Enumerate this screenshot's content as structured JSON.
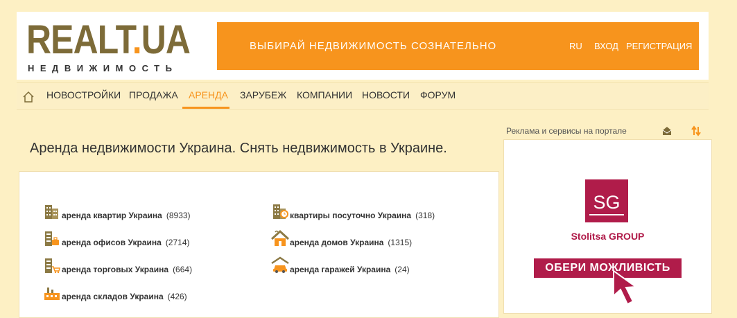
{
  "header": {
    "logo_main": "REALT",
    "logo_dot": ".",
    "logo_tld": "UA",
    "logo_sub": "НЕДВИЖИМОСТЬ",
    "slogan": "ВЫБИРАЙ НЕДВИЖИМОСТЬ СОЗНАТЕЛЬНО",
    "lang": "RU",
    "login": "ВХОД",
    "register": "РЕГИСТРАЦИЯ"
  },
  "nav": {
    "items": [
      {
        "label": "НОВОСТРОЙКИ"
      },
      {
        "label": "ПРОДАЖА"
      },
      {
        "label": "АРЕНДА"
      },
      {
        "label": "ЗАРУБЕЖ"
      },
      {
        "label": "КОМПАНИИ"
      },
      {
        "label": "НОВОСТИ"
      },
      {
        "label": "ФОРУМ"
      }
    ],
    "active": "АРЕНДА"
  },
  "main": {
    "title": "Аренда недвижимости Украина. Снять недвижимость в Украине.",
    "links": [
      {
        "label": "аренда квартир Украина",
        "count": "(8933)",
        "icon": "apartment-building-icon"
      },
      {
        "label": "аренда офисов Украина",
        "count": "(2714)",
        "icon": "office-icon"
      },
      {
        "label": "аренда торговых Украина",
        "count": "(664)",
        "icon": "retail-icon"
      },
      {
        "label": "аренда складов Украина",
        "count": "(426)",
        "icon": "warehouse-icon"
      },
      {
        "label": "квартиры посуточно Украина",
        "count": "(318)",
        "icon": "daily-rent-icon"
      },
      {
        "label": "аренда домов Украина",
        "count": "(1315)",
        "icon": "house-icon"
      },
      {
        "label": "аренда гаражей Украина",
        "count": "(24)",
        "icon": "garage-icon"
      }
    ]
  },
  "sidebar": {
    "label": "Реклама и сервисы на портале",
    "ad": {
      "logo_text": "SG",
      "company": "Stolitsa GROUP",
      "button": "ОБЕРИ МОЖЛИВІСТЬ"
    }
  },
  "colors": {
    "accent": "#f7941d",
    "logo": "#7d6b38",
    "background": "#fdf0c4",
    "ad_brand": "#b01c4a"
  }
}
